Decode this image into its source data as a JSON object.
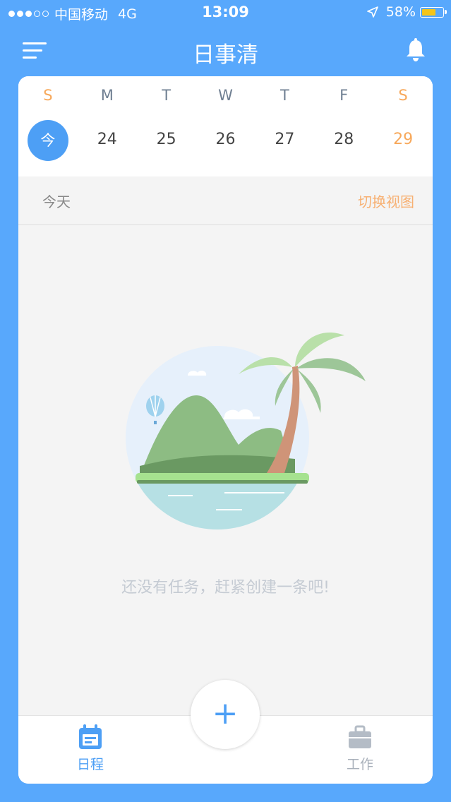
{
  "status_bar": {
    "carrier": "中国移动",
    "network": "4G",
    "time": "13:09",
    "battery": "58%",
    "battery_level": 0.58,
    "signal_bars_filled": 3,
    "signal_bars_total": 5
  },
  "header": {
    "title": "日事清",
    "menu_icon": "menu-icon",
    "bell_icon": "bell-icon"
  },
  "calendar": {
    "weekdays": [
      "S",
      "M",
      "T",
      "W",
      "T",
      "F",
      "S"
    ],
    "dates": [
      "今",
      "24",
      "25",
      "26",
      "27",
      "28",
      "29"
    ],
    "weekend_color": "#f7a85a",
    "today_color": "#4d9ff5"
  },
  "section": {
    "label": "今天",
    "switch_view": "切换视图"
  },
  "empty_state": {
    "message": "还没有任务，赶紧创建一条吧!",
    "illustration": "island-palm-tree"
  },
  "tabbar": {
    "schedule_label": "日程",
    "work_label": "工作",
    "add_label": "+"
  },
  "colors": {
    "background": "#58a8fc",
    "accent": "#4d9ff5",
    "orange": "#f7a85a",
    "inactive": "#a8b0ba"
  }
}
